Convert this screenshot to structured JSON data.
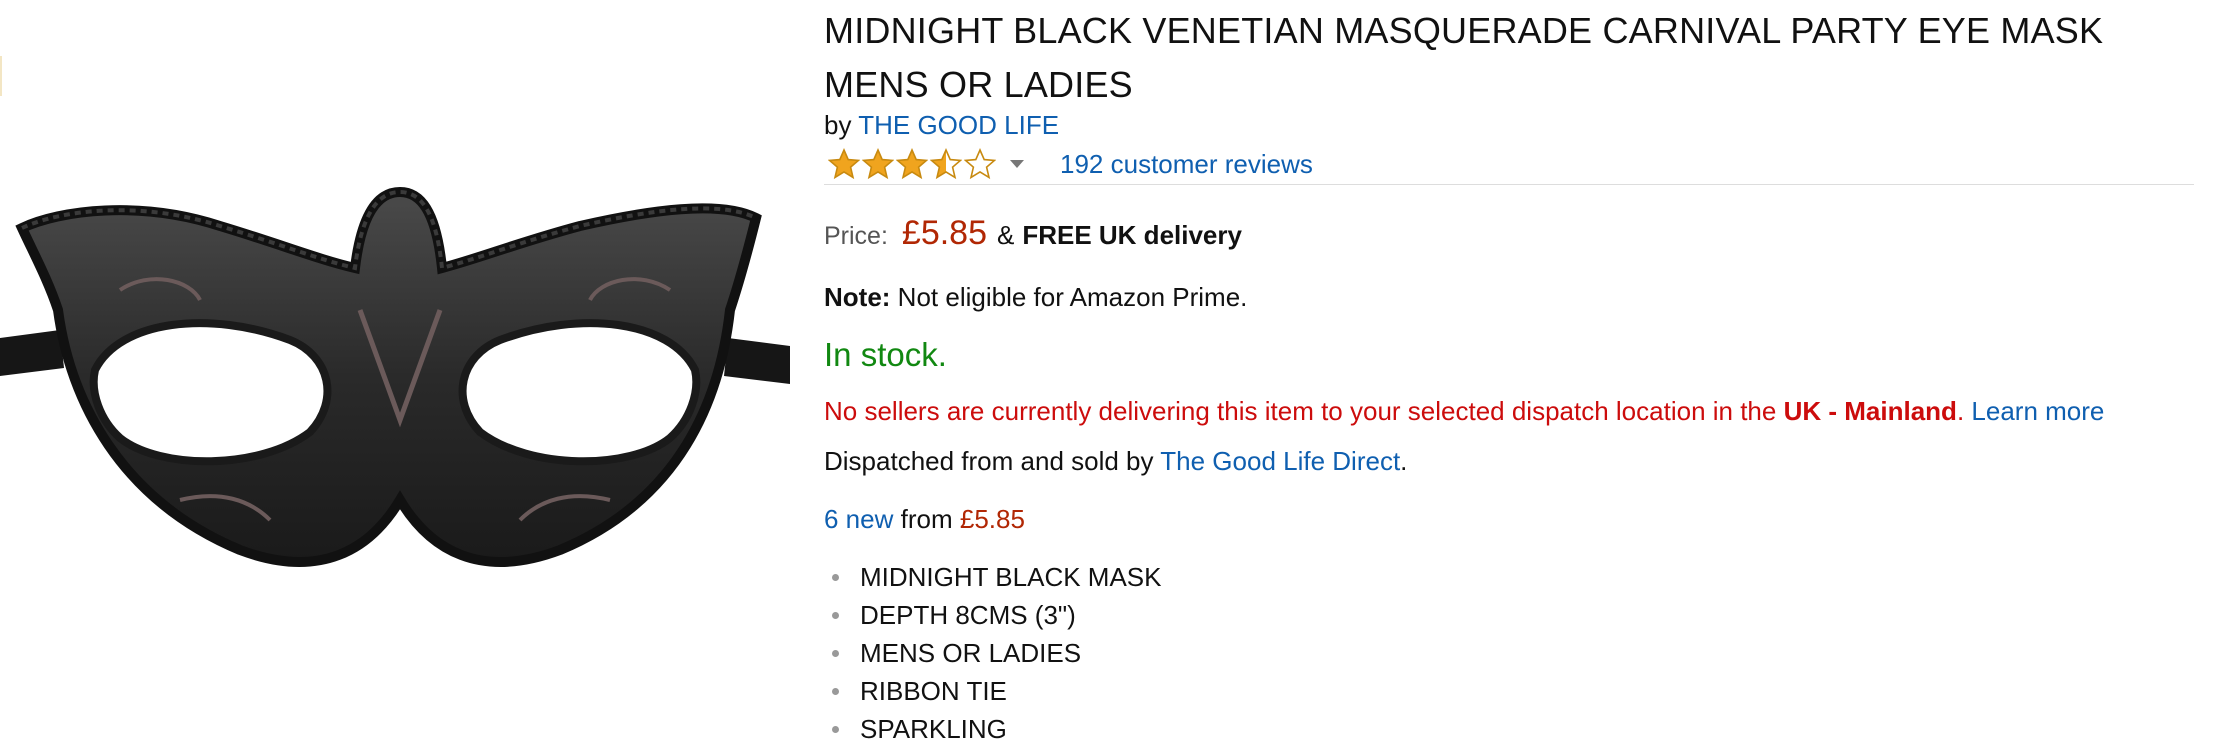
{
  "product": {
    "image_alt": "Black Venetian masquerade eye mask",
    "title": "MIDNIGHT BLACK VENETIAN MASQUERADE CARNIVAL PARTY EYE MASK MENS OR LADIES",
    "by_prefix": "by",
    "brand": "THE GOOD LIFE",
    "rating": {
      "value": 3.5,
      "max": 5,
      "filled_color": "#f0a41e",
      "empty_color": "#f0a41e"
    },
    "reviews_link": "192 customer reviews",
    "price": {
      "label": "Price:",
      "value": "£5.85",
      "amp": "&",
      "delivery": "FREE UK delivery"
    },
    "note": {
      "label": "Note:",
      "text": "Not eligible for Amazon Prime."
    },
    "stock": "In stock.",
    "delivery_warning": {
      "text": "No sellers are currently delivering this item to your selected dispatch location in the",
      "location": "UK - Mainland",
      "period": ".",
      "learn_more": "Learn more"
    },
    "dispatch": {
      "prefix": "Dispatched from and sold by",
      "seller": "The Good Life Direct",
      "suffix": "."
    },
    "offers": {
      "count_link": "6 new",
      "from_text": "from",
      "from_price": "£5.85"
    },
    "features": [
      "MIDNIGHT BLACK MASK",
      "DEPTH 8CMS (3\")",
      "MENS OR LADIES",
      "RIBBON TIE",
      "SPARKLING"
    ]
  },
  "colors": {
    "link": "#0f5fb0",
    "price": "#b12704",
    "in_stock": "#118811",
    "warning": "#cc0c0c"
  },
  "icons": {
    "rating_dropdown": "caret-down-icon",
    "star": "star-icon"
  }
}
